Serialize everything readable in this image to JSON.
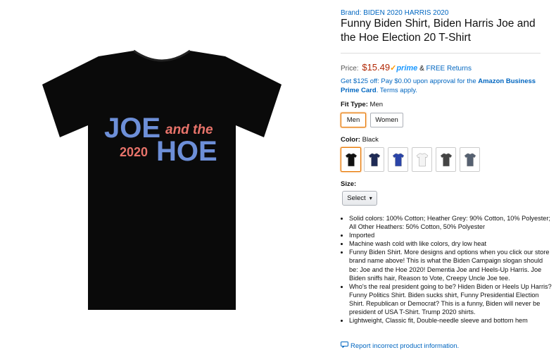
{
  "product": {
    "brand": "Brand: BIDEN 2020 HARRIS 2020",
    "title": "Funny Biden Shirt, Biden Harris Joe and the Hoe Election 20 T-Shirt",
    "shirt_print": {
      "line1a": "JOE",
      "line1b": "and the",
      "line2a": "2020",
      "line2b": "HOE"
    }
  },
  "price": {
    "label": "Price:",
    "value": "$15.49",
    "prime": "prime",
    "amp": "&",
    "returns": "FREE Returns"
  },
  "promo": {
    "text_before": "Get $125 off: Pay $0.00 upon approval for the",
    "card": "Amazon Business Prime Card",
    "terms": "Terms apply."
  },
  "fit": {
    "label": "Fit Type:",
    "value": "Men",
    "options": [
      "Men",
      "Women"
    ],
    "selected": "Men"
  },
  "color": {
    "label": "Color:",
    "value": "Black",
    "swatches": [
      {
        "name": "Black",
        "hex": "#111111"
      },
      {
        "name": "Navy",
        "hex": "#1e2a55"
      },
      {
        "name": "Royal Blue",
        "hex": "#2a44a8"
      },
      {
        "name": "White",
        "hex": "#f4f4f4"
      },
      {
        "name": "Asphalt",
        "hex": "#444444"
      },
      {
        "name": "Slate",
        "hex": "#556070"
      }
    ]
  },
  "size": {
    "label": "Size:",
    "select_value": "Select"
  },
  "bullets": [
    "Solid colors: 100% Cotton; Heather Grey: 90% Cotton, 10% Polyester; All Other Heathers: 50% Cotton, 50% Polyester",
    "Imported",
    "Machine wash cold with like colors, dry low heat",
    "Funny Biden Shirt. More designs and options when you click our store brand name above! This is what the Biden Campaign slogan should be: Joe and the Hoe 2020! Dementia Joe and Heels-Up Harris. Joe Biden sniffs hair, Reason to Vote, Creepy Uncle Joe tee.",
    "Who's the real president going to be? Hiden Biden or Heels Up Harris? Funny Politics Shirt. Biden sucks shirt, Funny Presidential Election Shirt. Republican or Democrat? This is a funny, Biden will never be president of USA T-Shirt. Trump 2020 shirts.",
    "Lightweight, Classic fit, Double-needle sleeve and bottom hem"
  ],
  "report": "Report incorrect product information.",
  "colors": {
    "link": "#0066c0",
    "price": "#b12704",
    "selected": "#e77600",
    "print_blue": "#6d8fd8",
    "print_red": "#e8736a"
  }
}
